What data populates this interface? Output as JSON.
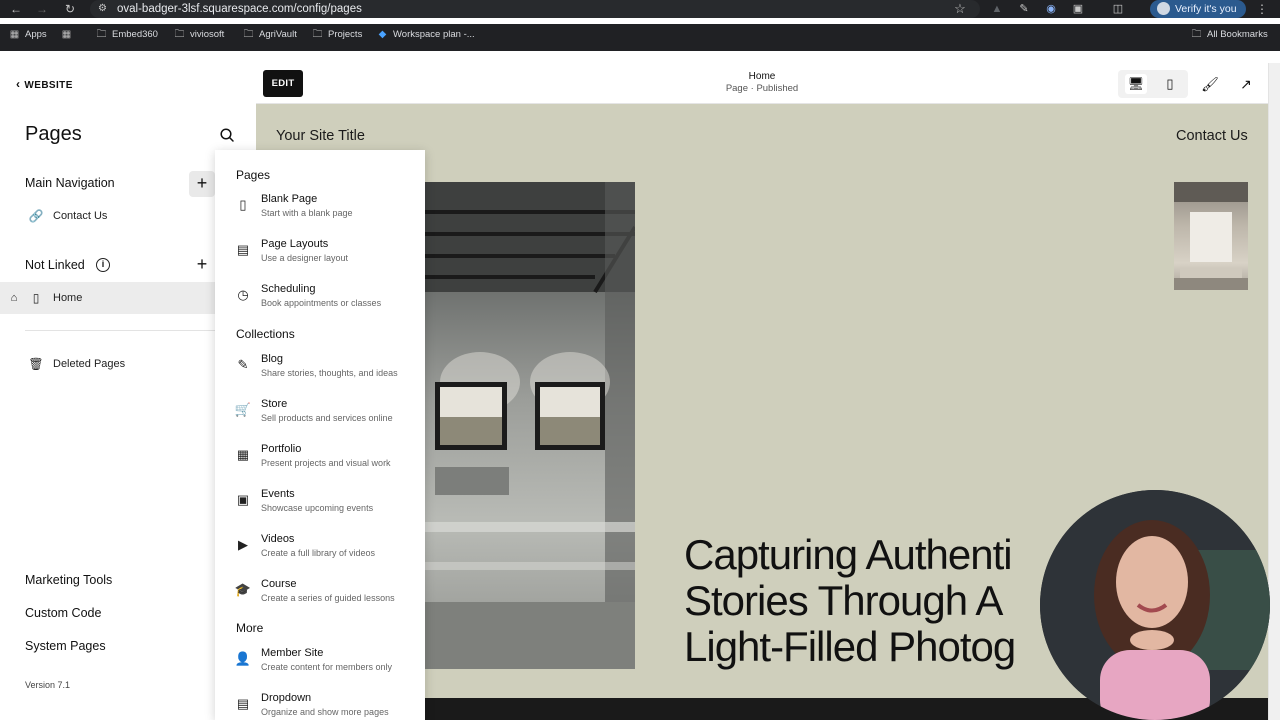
{
  "browser": {
    "url": "oval-badger-3lsf.squarespace.com/config/pages",
    "verify_label": "Verify it's you",
    "bookmarks": [
      "Apps",
      "Embed360",
      "viviosoft",
      "AgriVault",
      "Projects",
      "Workspace plan -...",
      "All Bookmarks"
    ]
  },
  "sidebar": {
    "back_label": "WEBSITE",
    "title": "Pages",
    "main_nav": {
      "label": "Main Navigation",
      "items": [
        {
          "label": "Contact Us",
          "icon": "link-icon"
        }
      ]
    },
    "not_linked": {
      "label": "Not Linked",
      "items": [
        {
          "label": "Home",
          "icon": "page-icon"
        }
      ]
    },
    "deleted_label": "Deleted Pages",
    "bottom_links": [
      "Marketing Tools",
      "Custom Code",
      "System Pages"
    ],
    "version": "Version 7.1"
  },
  "preview_bar": {
    "edit_label": "EDIT",
    "page_name": "Home",
    "page_status": "Page · Published"
  },
  "site": {
    "title": "Your Site Title",
    "nav_contact": "Contact Us",
    "hero_lines": [
      "Capturing Authenti",
      "Stories Through A",
      "Light-Filled Photog"
    ]
  },
  "menu": {
    "groups": [
      {
        "heading": "Pages",
        "items": [
          {
            "label": "Blank Page",
            "desc": "Start with a blank page",
            "icon": "blank-page-icon"
          },
          {
            "label": "Page Layouts",
            "desc": "Use a designer layout",
            "icon": "layout-icon"
          },
          {
            "label": "Scheduling",
            "desc": "Book appointments or classes",
            "icon": "clock-icon"
          }
        ]
      },
      {
        "heading": "Collections",
        "items": [
          {
            "label": "Blog",
            "desc": "Share stories, thoughts, and ideas",
            "icon": "blog-icon"
          },
          {
            "label": "Store",
            "desc": "Sell products and services online",
            "icon": "cart-icon"
          },
          {
            "label": "Portfolio",
            "desc": "Present projects and visual work",
            "icon": "grid-icon"
          },
          {
            "label": "Events",
            "desc": "Showcase upcoming events",
            "icon": "calendar-icon"
          },
          {
            "label": "Videos",
            "desc": "Create a full library of videos",
            "icon": "video-icon"
          },
          {
            "label": "Course",
            "desc": "Create a series of guided lessons",
            "icon": "course-icon"
          }
        ]
      },
      {
        "heading": "More",
        "items": [
          {
            "label": "Member Site",
            "desc": "Create content for members only",
            "icon": "member-icon"
          },
          {
            "label": "Dropdown",
            "desc": "Organize and show more pages",
            "icon": "dropdown-icon"
          }
        ]
      }
    ]
  }
}
